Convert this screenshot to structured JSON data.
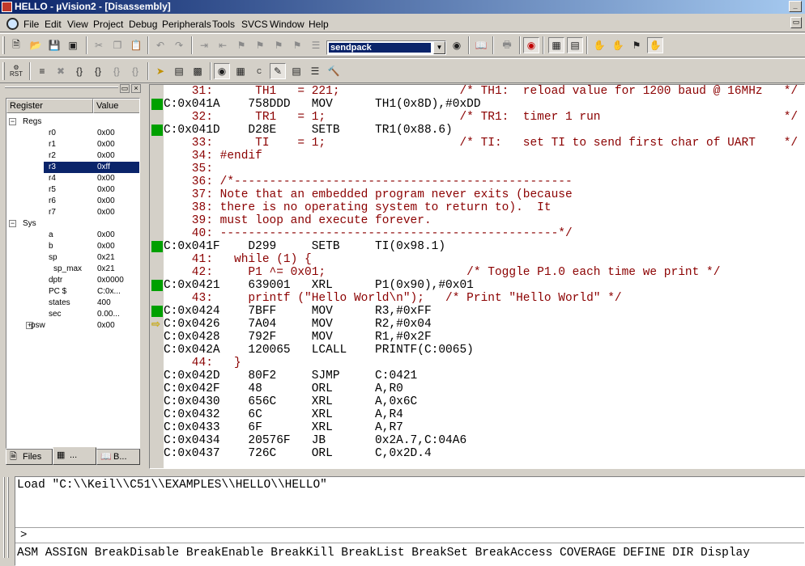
{
  "window": {
    "title": "HELLO - µVision2 - [Disassembly]"
  },
  "menubar": {
    "items": [
      "File",
      "Edit",
      "View",
      "Project",
      "Debug",
      "Peripherals",
      "Tools",
      "SVCS",
      "Window",
      "Help"
    ]
  },
  "toolbar": {
    "find_value": "sendpack",
    "rst_label": "RST"
  },
  "registers": {
    "col_register": "Register",
    "col_value": "Value",
    "rows": [
      {
        "name": "Regs",
        "value": "",
        "level": 0,
        "expander": "−"
      },
      {
        "name": "r0",
        "value": "0x00",
        "level": 2
      },
      {
        "name": "r1",
        "value": "0x00",
        "level": 2
      },
      {
        "name": "r2",
        "value": "0x00",
        "level": 2
      },
      {
        "name": "r3",
        "value": "0xff",
        "level": 2,
        "selected": true
      },
      {
        "name": "r4",
        "value": "0x00",
        "level": 2
      },
      {
        "name": "r5",
        "value": "0x00",
        "level": 2
      },
      {
        "name": "r6",
        "value": "0x00",
        "level": 2
      },
      {
        "name": "r7",
        "value": "0x00",
        "level": 2
      },
      {
        "name": "Sys",
        "value": "",
        "level": 0,
        "expander": "−"
      },
      {
        "name": "a",
        "value": "0x00",
        "level": 2
      },
      {
        "name": "b",
        "value": "0x00",
        "level": 2
      },
      {
        "name": "sp",
        "value": "0x21",
        "level": 2
      },
      {
        "name": "sp_max",
        "value": "0x21",
        "level": 3
      },
      {
        "name": "dptr",
        "value": "0x0000",
        "level": 2
      },
      {
        "name": "PC  $",
        "value": "C:0x...",
        "level": 2
      },
      {
        "name": "states",
        "value": "400",
        "level": 2
      },
      {
        "name": "sec",
        "value": "0.00...",
        "level": 2
      },
      {
        "name": "psw",
        "value": "0x00",
        "level": 1,
        "expander": "+"
      }
    ],
    "tabs": [
      "Files",
      "...",
      "B..."
    ]
  },
  "disassembly": {
    "lines": [
      {
        "text": "    31:      TH1   = 221;                 /* TH1:  reload value for 1200 baud @ 16MHz   */",
        "kind": "src"
      },
      {
        "text": "C:0x041A    758DDD   MOV      TH1(0x8D),#0xDD",
        "kind": "asm",
        "bp": true
      },
      {
        "text": "    32:      TR1   = 1;                   /* TR1:  timer 1 run                          */",
        "kind": "src"
      },
      {
        "text": "C:0x041D    D28E     SETB     TR1(0x88.6)",
        "kind": "asm",
        "bp": true
      },
      {
        "text": "    33:      TI    = 1;                   /* TI:   set TI to send first char of UART    */",
        "kind": "src"
      },
      {
        "text": "    34: #endif",
        "kind": "src"
      },
      {
        "text": "    35: ",
        "kind": "src"
      },
      {
        "text": "    36: /*------------------------------------------------",
        "kind": "src"
      },
      {
        "text": "    37: Note that an embedded program never exits (because",
        "kind": "src"
      },
      {
        "text": "    38: there is no operating system to return to).  It",
        "kind": "src"
      },
      {
        "text": "    39: must loop and execute forever.",
        "kind": "src"
      },
      {
        "text": "    40: ------------------------------------------------*/",
        "kind": "src"
      },
      {
        "text": "C:0x041F    D299     SETB     TI(0x98.1)",
        "kind": "asm",
        "bp": true
      },
      {
        "text": "    41:   while (1) {",
        "kind": "src"
      },
      {
        "text": "    42:     P1 ^= 0x01;                    /* Toggle P1.0 each time we print */",
        "kind": "src"
      },
      {
        "text": "C:0x0421    639001   XRL      P1(0x90),#0x01",
        "kind": "asm",
        "bp": true
      },
      {
        "text": "    43:     printf (\"Hello World\\n\");   /* Print \"Hello World\" */",
        "kind": "src"
      },
      {
        "text": "C:0x0424    7BFF     MOV      R3,#0xFF",
        "kind": "asm",
        "bp": true
      },
      {
        "text": "C:0x0426    7A04     MOV      R2,#0x04",
        "kind": "asm",
        "arrow": true
      },
      {
        "text": "C:0x0428    792F     MOV      R1,#0x2F",
        "kind": "asm"
      },
      {
        "text": "C:0x042A    120065   LCALL    PRINTF(C:0065)",
        "kind": "asm"
      },
      {
        "text": "    44:   }",
        "kind": "src"
      },
      {
        "text": "C:0x042D    80F2     SJMP     C:0421",
        "kind": "asm"
      },
      {
        "text": "C:0x042F    48       ORL      A,R0",
        "kind": "asm"
      },
      {
        "text": "C:0x0430    656C     XRL      A,0x6C",
        "kind": "asm"
      },
      {
        "text": "C:0x0432    6C       XRL      A,R4",
        "kind": "asm"
      },
      {
        "text": "C:0x0433    6F       XRL      A,R7",
        "kind": "asm"
      },
      {
        "text": "C:0x0434    20576F   JB       0x2A.7,C:04A6",
        "kind": "asm"
      },
      {
        "text": "C:0x0437    726C     ORL      C,0x2D.4",
        "kind": "asm"
      }
    ]
  },
  "output": {
    "line1": "Load \"C:\\\\Keil\\\\C51\\\\EXAMPLES\\\\HELLO\\\\HELLO\"",
    "prompt": ">",
    "help": "ASM ASSIGN BreakDisable BreakEnable BreakKill BreakList BreakSet BreakAccess COVERAGE DEFINE DIR Display"
  },
  "icons": [
    "cut-icon",
    "copy-icon",
    "paste-icon",
    "undo-icon",
    "redo-icon",
    "find-icon",
    "run-icon",
    "stop-icon",
    "step-into-icon",
    "step-over-icon",
    "step-out-icon",
    "run-to-cursor-icon"
  ]
}
